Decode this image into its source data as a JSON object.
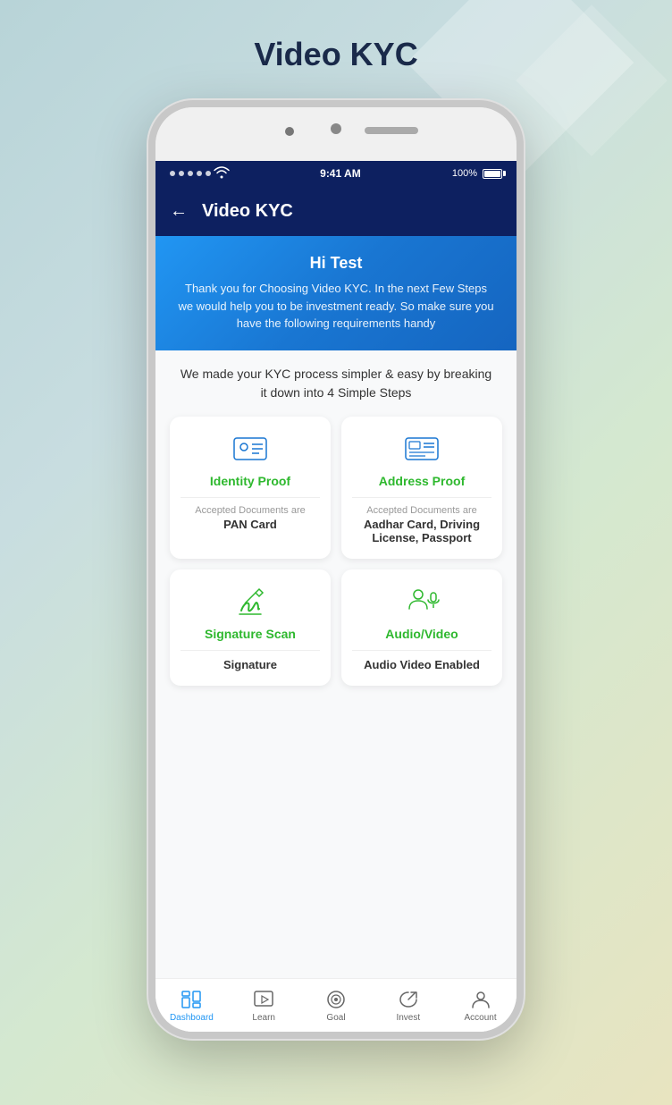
{
  "page": {
    "title": "Video KYC",
    "background_color": "#b8d4d8"
  },
  "status_bar": {
    "time": "9:41 AM",
    "battery": "100%",
    "signal_dots": 5
  },
  "header": {
    "title": "Video KYC",
    "back_label": "←"
  },
  "welcome_card": {
    "greeting": "Hi Test",
    "message": "Thank you for Choosing Video KYC. In the next Few Steps we would help you to be investment ready. So make sure you have the following requirements handy"
  },
  "subtitle": "We made your KYC process simpler & easy by breaking it down into 4 Simple Steps",
  "steps": [
    {
      "id": "identity",
      "title": "Identity Proof",
      "accepted_label": "Accepted Documents are",
      "docs": "PAN Card"
    },
    {
      "id": "address",
      "title": "Address Proof",
      "accepted_label": "Accepted Documents are",
      "docs": "Aadhar Card, Driving License, Passport"
    },
    {
      "id": "signature",
      "title": "Signature Scan",
      "accepted_label": "",
      "docs": "Signature"
    },
    {
      "id": "audio",
      "title": "Audio/Video",
      "accepted_label": "",
      "docs": "Audio Video Enabled"
    }
  ],
  "bottom_nav": [
    {
      "id": "dashboard",
      "label": "Dashboard",
      "active": true
    },
    {
      "id": "learn",
      "label": "Learn",
      "active": false
    },
    {
      "id": "goal",
      "label": "Goal",
      "active": false
    },
    {
      "id": "invest",
      "label": "Invest",
      "active": false
    },
    {
      "id": "account",
      "label": "Account",
      "active": false
    }
  ]
}
